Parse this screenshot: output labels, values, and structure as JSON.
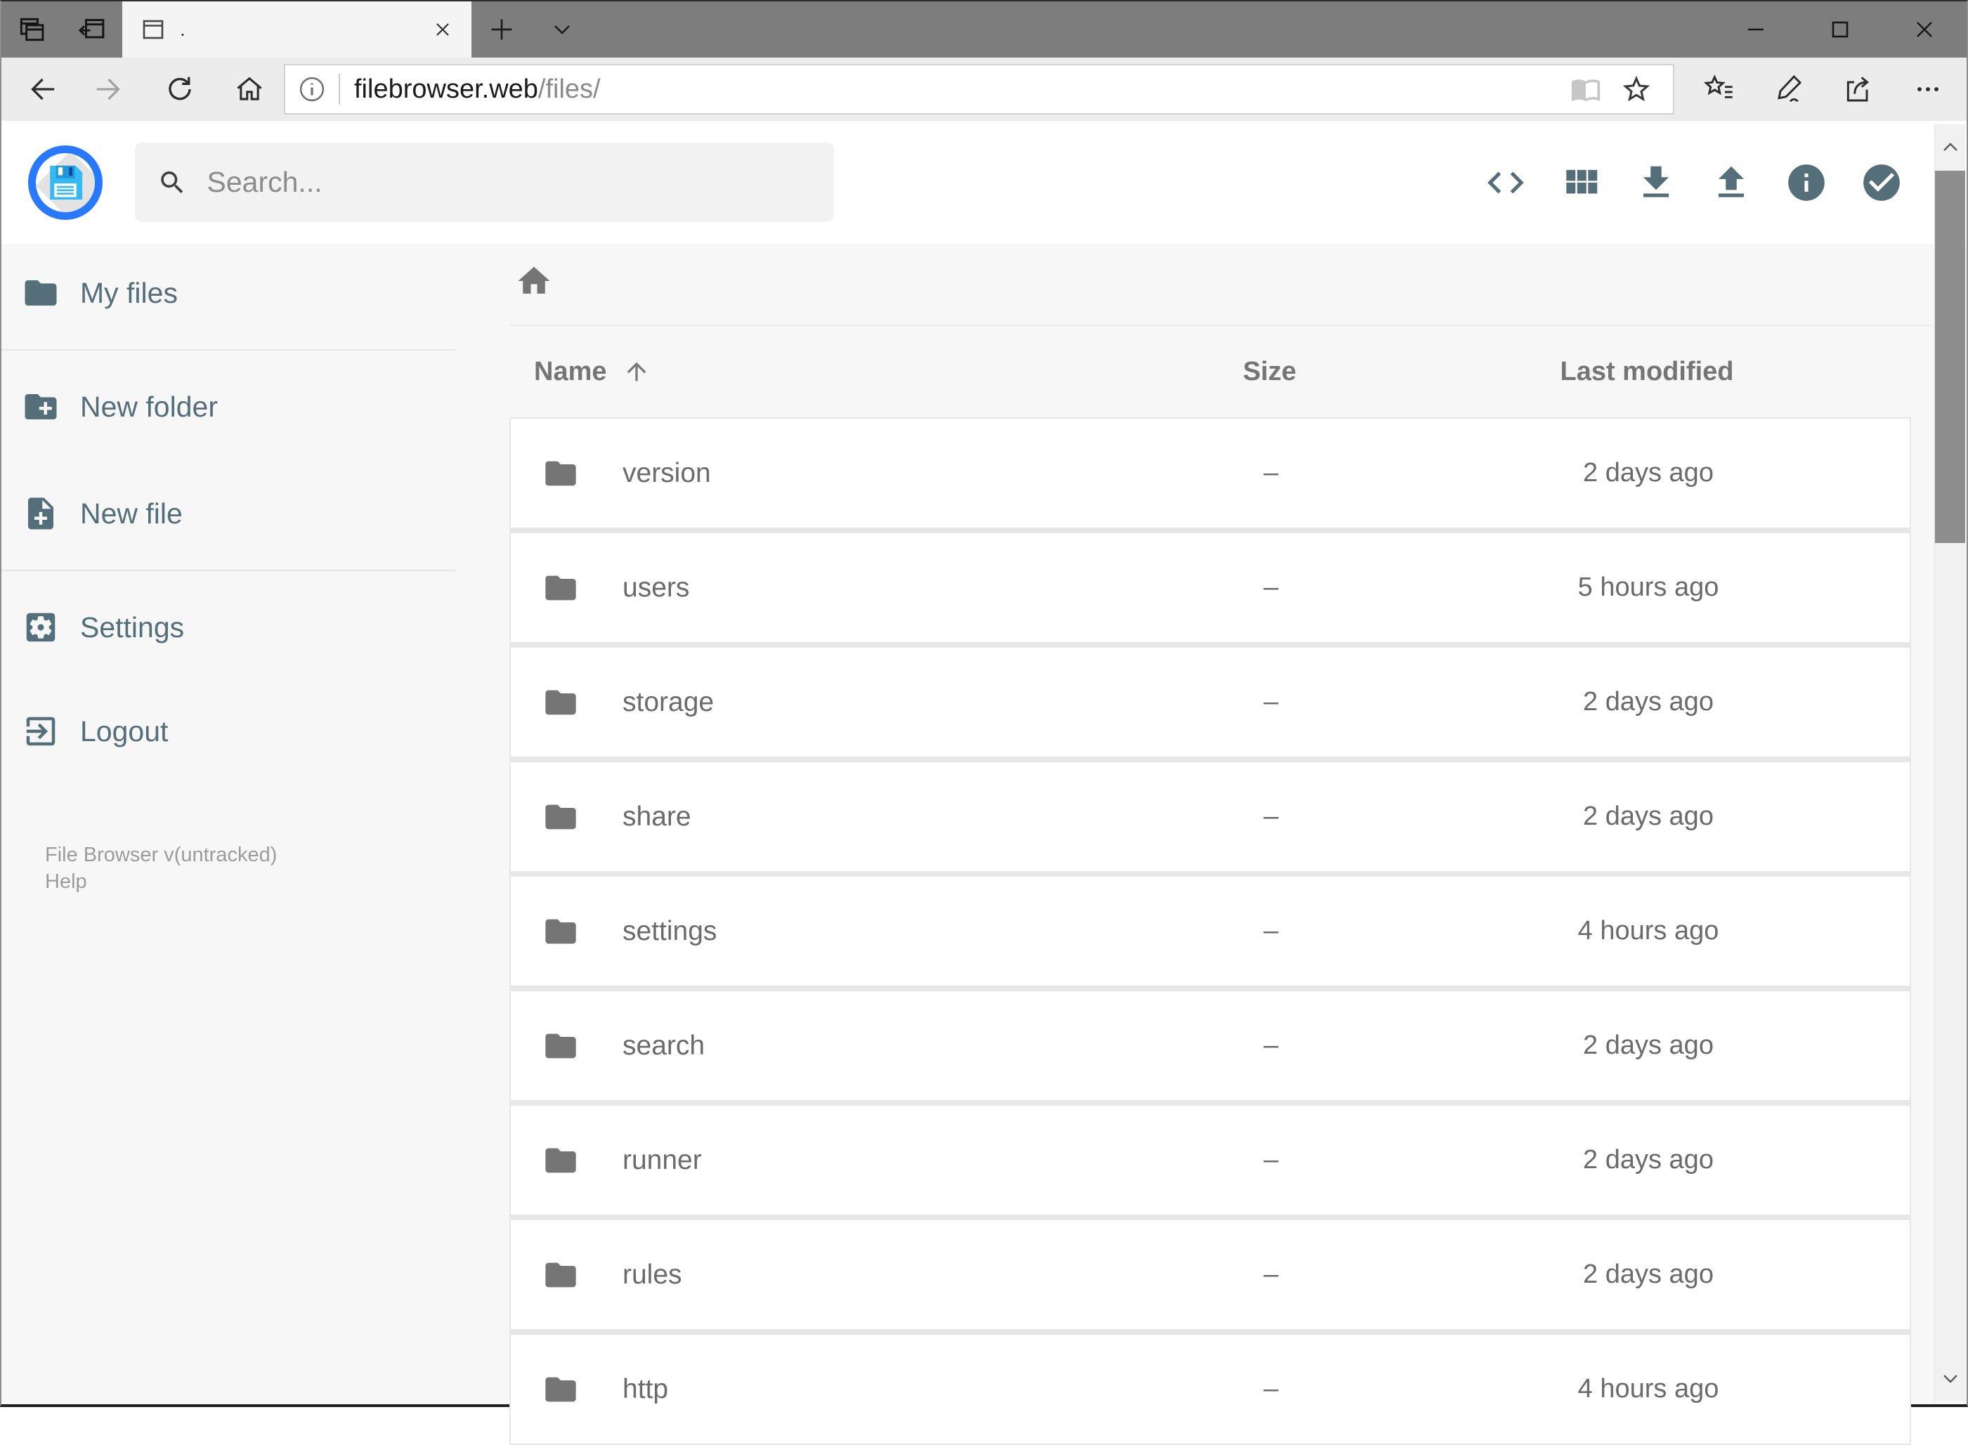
{
  "browser": {
    "titlebar": {
      "tab_title": ".",
      "icons": [
        "tab-preview",
        "set-tabs-aside",
        "page",
        "close",
        "new-tab",
        "tab-dropdown",
        "minimize",
        "maximize",
        "close-window"
      ]
    },
    "navbar": {
      "url_domain": "filebrowser.web",
      "url_path": "/files/",
      "icons": [
        "back",
        "forward",
        "refresh",
        "home",
        "site-info",
        "reading-view",
        "favorite-star",
        "hub-favorites",
        "annotate-pen",
        "share",
        "more-options"
      ]
    }
  },
  "app": {
    "search_placeholder": "Search...",
    "toolbar_icons": [
      "code",
      "grid-view",
      "download",
      "upload",
      "info",
      "check-circle"
    ],
    "sidebar": {
      "items": [
        {
          "label": "My files",
          "icon": "folder"
        },
        {
          "label": "New folder",
          "icon": "folder-plus"
        },
        {
          "label": "New file",
          "icon": "file-plus"
        },
        {
          "label": "Settings",
          "icon": "gear"
        },
        {
          "label": "Logout",
          "icon": "logout"
        }
      ],
      "version_text": "File Browser v(untracked)",
      "help_text": "Help"
    },
    "listing": {
      "breadcrumb_icon": "home",
      "columns": {
        "name": "Name",
        "size": "Size",
        "modified": "Last modified"
      },
      "sort": {
        "column": "Name",
        "direction": "asc"
      },
      "rows": [
        {
          "name": "version",
          "size": "–",
          "modified": "2 days ago"
        },
        {
          "name": "users",
          "size": "–",
          "modified": "5 hours ago"
        },
        {
          "name": "storage",
          "size": "–",
          "modified": "2 days ago"
        },
        {
          "name": "share",
          "size": "–",
          "modified": "2 days ago"
        },
        {
          "name": "settings",
          "size": "–",
          "modified": "4 hours ago"
        },
        {
          "name": "search",
          "size": "–",
          "modified": "2 days ago"
        },
        {
          "name": "runner",
          "size": "–",
          "modified": "2 days ago"
        },
        {
          "name": "rules",
          "size": "–",
          "modified": "2 days ago"
        },
        {
          "name": "http",
          "size": "–",
          "modified": "4 hours ago"
        }
      ]
    }
  },
  "colors": {
    "accent_slate": "#546e7a",
    "logo_ring": "#2979ff",
    "logo_disk": "#35b9f5",
    "titlebar_gray": "#7d7d7d",
    "main_bg": "#f7f7f7",
    "row_text": "#6b6b6b"
  }
}
